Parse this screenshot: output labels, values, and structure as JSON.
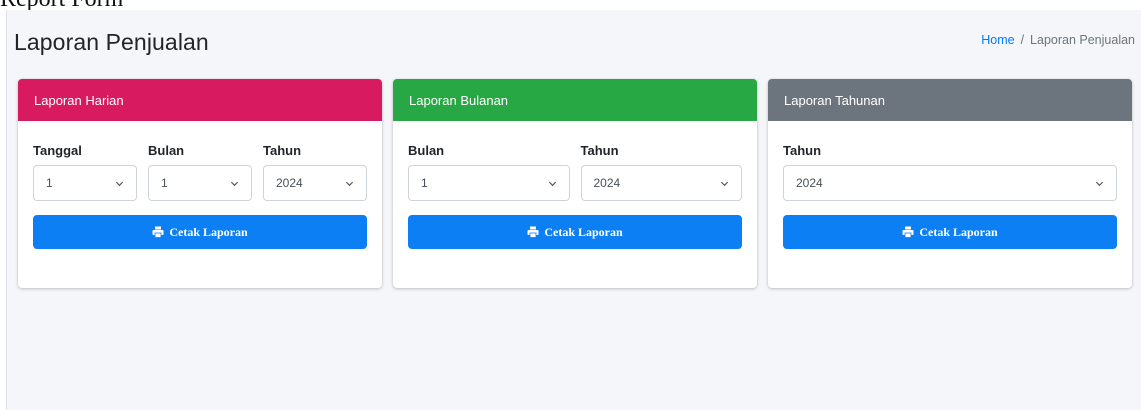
{
  "top_text": "Report Form",
  "page": {
    "title": "Laporan Penjualan",
    "breadcrumb": {
      "home": "Home",
      "separator": "/",
      "current": "Laporan Penjualan"
    }
  },
  "colors": {
    "daily": "#d81b60",
    "monthly": "#28a745",
    "yearly": "#6c757d",
    "button": "#0d7ff5"
  },
  "cards": {
    "daily": {
      "title": "Laporan Harian",
      "fields": {
        "day": {
          "label": "Tanggal",
          "value": "1"
        },
        "month": {
          "label": "Bulan",
          "value": "1"
        },
        "year": {
          "label": "Tahun",
          "value": "2024"
        }
      },
      "button": "Cetak Laporan"
    },
    "monthly": {
      "title": "Laporan Bulanan",
      "fields": {
        "month": {
          "label": "Bulan",
          "value": "1"
        },
        "year": {
          "label": "Tahun",
          "value": "2024"
        }
      },
      "button": "Cetak Laporan"
    },
    "yearly": {
      "title": "Laporan Tahunan",
      "fields": {
        "year": {
          "label": "Tahun",
          "value": "2024"
        }
      },
      "button": "Cetak Laporan"
    }
  },
  "icons": {
    "select": "chevron-down-icon",
    "print": "print-icon"
  }
}
